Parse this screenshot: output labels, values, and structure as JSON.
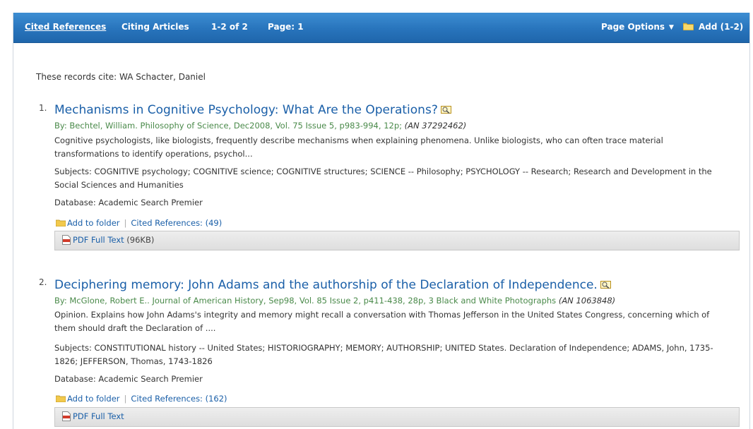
{
  "toolbar": {
    "cited_refs": "Cited References",
    "citing_articles": "Citing Articles",
    "range": "1-2 of 2",
    "page": "Page: 1",
    "page_options": "Page Options",
    "add": "Add (1-2)"
  },
  "intro": "These records cite: WA Schacter, Daniel",
  "results": [
    {
      "num": "1.",
      "title": "Mechanisms in Cognitive Psychology: What Are the Operations?",
      "byline": "By: Bechtel, William. Philosophy of Science, Dec2008, Vol. 75 Issue 5, p983-994, 12p;",
      "an": "(AN 37292462)",
      "abstract": "Cognitive psychologists, like biologists, frequently describe mechanisms when explaining phenomena. Unlike biologists, who can often trace material transformations to identify operations, psychol...",
      "subjects": "Subjects: COGNITIVE psychology; COGNITIVE science; COGNITIVE structures; SCIENCE -- Philosophy; PSYCHOLOGY -- Research; Research and Development in the Social Sciences and Humanities",
      "database": "Database: Academic Search Premier",
      "add_folder": "Add to folder",
      "cited_refs": "Cited References: (49)",
      "pdf": "PDF Full Text",
      "pdf_size": "(96KB)"
    },
    {
      "num": "2.",
      "title": "Deciphering memory: John Adams and the authorship of the Declaration of Independence.",
      "byline": "By: McGlone, Robert E.. Journal of American History, Sep98, Vol. 85 Issue 2, p411-438, 28p, 3 Black and White Photographs",
      "an": "(AN 1063848)",
      "abstract": "Opinion. Explains how John Adams's integrity and memory might recall a conversation with Thomas Jefferson in the United States Congress, concerning which of them should draft the Declaration of ....",
      "subjects": "Subjects: CONSTITUTIONAL history -- United States; HISTORIOGRAPHY; MEMORY; AUTHORSHIP; UNITED States. Declaration of Independence; ADAMS, John, 1735-1826; JEFFERSON, Thomas, 1743-1826",
      "database": "Database: Academic Search Premier",
      "add_folder": "Add to folder",
      "cited_refs": "Cited References: (162)",
      "pdf": "PDF Full Text"
    }
  ]
}
